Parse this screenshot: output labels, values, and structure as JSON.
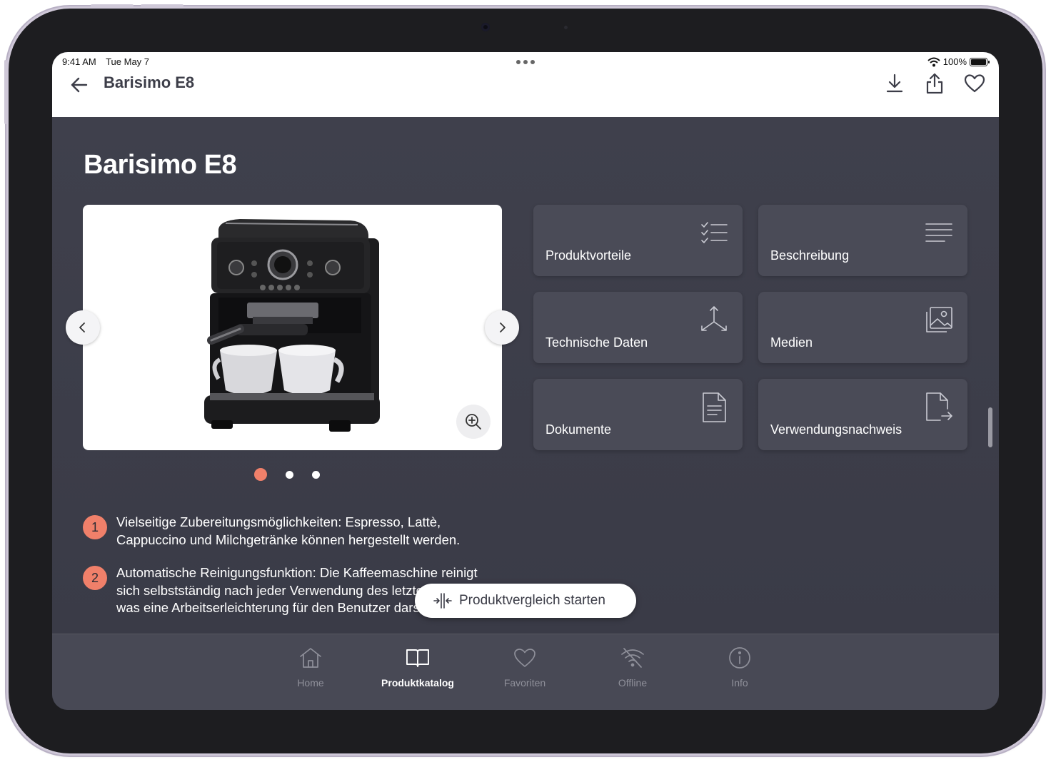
{
  "status": {
    "time": "9:41 AM",
    "date": "Tue May 7",
    "battery": "100%"
  },
  "nav": {
    "title": "Barisimo E8",
    "actions": [
      {
        "icon": "download-icon"
      },
      {
        "icon": "share-icon"
      },
      {
        "icon": "heart-icon"
      }
    ]
  },
  "product": {
    "title": "Barisimo E8",
    "image_icon": "espresso-machine-image",
    "carousel": {
      "pages": 3,
      "active": 1
    }
  },
  "tiles": [
    {
      "label": "Produktvorteile",
      "icon": "checklist-icon"
    },
    {
      "label": "Beschreibung",
      "icon": "text-lines-icon"
    },
    {
      "label": "Technische Daten",
      "icon": "axes-3d-icon"
    },
    {
      "label": "Medien",
      "icon": "media-gallery-icon"
    },
    {
      "label": "Dokumente",
      "icon": "document-icon"
    },
    {
      "label": "Verwendungsnachweis",
      "icon": "document-export-icon"
    }
  ],
  "features": [
    {
      "num": "1",
      "text": "Vielseitige Zubereitungsmöglichkeiten: Espresso, Lattè, Cappuccino und Milchgetränke können hergestellt werden."
    },
    {
      "num": "2",
      "text": "Automatische Reinigungsfunktion: Die Kaffeemaschine reinigt sich selbstständig nach jeder Verwendung des letzten Getränks, was eine Arbeitserleichterung für den Benutzer darstellt."
    }
  ],
  "compare": {
    "label": "Produktvergleich starten",
    "icon": "compare-icon"
  },
  "tabbar": [
    {
      "label": "Home",
      "icon": "home-icon",
      "active": false
    },
    {
      "label": "Produktkatalog",
      "icon": "book-icon",
      "active": true
    },
    {
      "label": "Favoriten",
      "icon": "heart-icon",
      "active": false
    },
    {
      "label": "Offline",
      "icon": "wifi-off-icon",
      "active": false
    },
    {
      "label": "Info",
      "icon": "info-icon",
      "active": false
    }
  ],
  "colors": {
    "accent": "#f0806a",
    "background": "#3e3f4b",
    "tile": "#4a4b57"
  }
}
